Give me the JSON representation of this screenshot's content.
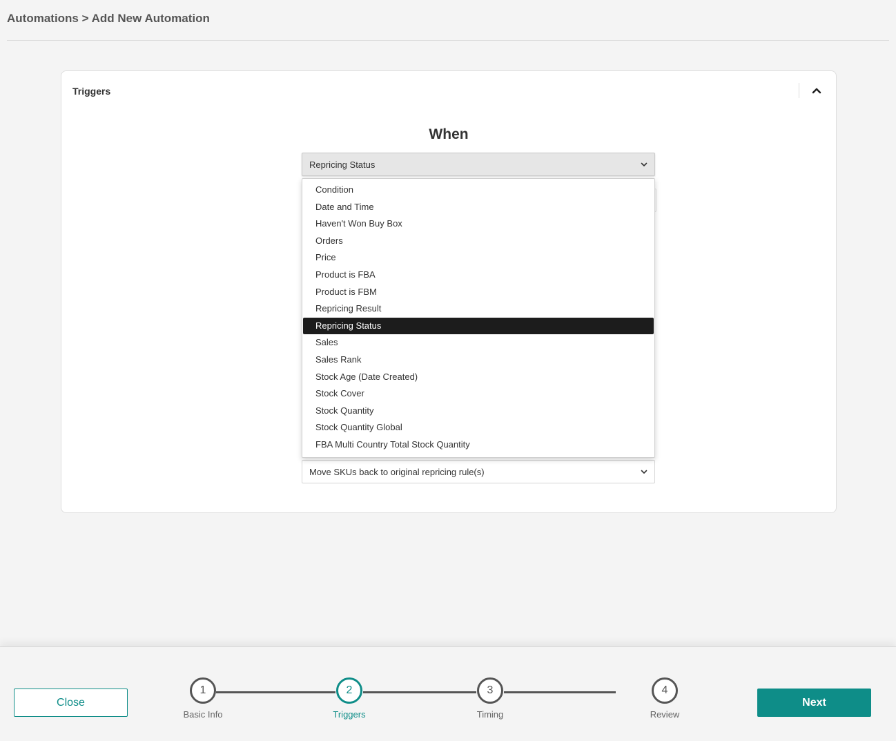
{
  "breadcrumb": "Automations > Add New Automation",
  "card": {
    "title": "Triggers",
    "when_label": "When"
  },
  "trigger_select": {
    "value": "Repricing Status",
    "options": [
      "Condition",
      "Date and Time",
      "Haven't Won Buy Box",
      "Orders",
      "Price",
      "Product is FBA",
      "Product is FBM",
      "Repricing Result",
      "Repricing Status",
      "Sales",
      "Sales Rank",
      "Stock Age (Date Created)",
      "Stock Cover",
      "Stock Quantity",
      "Stock Quantity Global",
      "FBA Multi Country Total Stock Quantity"
    ],
    "selected_index": 8
  },
  "action_select": {
    "value": "Move SKUs back to original repricing rule(s)"
  },
  "footer": {
    "close_label": "Close",
    "next_label": "Next",
    "steps": [
      {
        "number": "1",
        "label": "Basic Info",
        "active": false
      },
      {
        "number": "2",
        "label": "Triggers",
        "active": true
      },
      {
        "number": "3",
        "label": "Timing",
        "active": false
      },
      {
        "number": "4",
        "label": "Review",
        "active": false
      }
    ]
  },
  "colors": {
    "accent": "#0e8d88",
    "selected_bg": "#1c1c1c",
    "page_bg": "#f4f4f4"
  },
  "icons": {
    "collapse": "chevron-up-icon",
    "select_arrow": "chevron-down-icon"
  }
}
